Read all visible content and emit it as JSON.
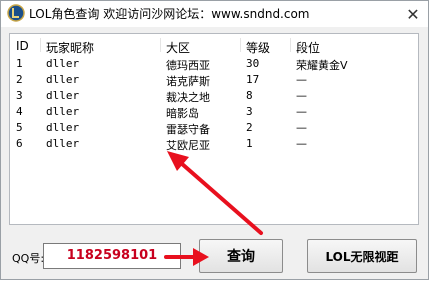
{
  "window": {
    "title": "LOL角色查询  欢迎访问沙网论坛：www.sndnd.com",
    "close_glyph": "✕"
  },
  "table": {
    "columns": [
      "ID",
      "玩家昵称",
      "大区",
      "等级",
      "段位"
    ],
    "rows": [
      {
        "id": "1",
        "name": "dller",
        "region": "德玛西亚",
        "level": "30",
        "rank": "荣耀黄金V"
      },
      {
        "id": "2",
        "name": "dller",
        "region": "诺克萨斯",
        "level": "17",
        "rank": "—"
      },
      {
        "id": "3",
        "name": "dller",
        "region": "裁决之地",
        "level": "8",
        "rank": "—"
      },
      {
        "id": "4",
        "name": "dller",
        "region": "暗影岛",
        "level": "3",
        "rank": "—"
      },
      {
        "id": "5",
        "name": "dller",
        "region": "雷瑟守备",
        "level": "2",
        "rank": "—"
      },
      {
        "id": "6",
        "name": "dller",
        "region": "艾欧尼亚",
        "level": "1",
        "rank": "—"
      }
    ]
  },
  "form": {
    "qq_label": "QQ号:",
    "qq_value": "1182598101",
    "query_button": "查询",
    "lol_button": "LOL无限视距"
  },
  "colors": {
    "annotation_arrow": "#e8101e",
    "qq_text": "#c8001e"
  },
  "icons": {
    "app": "lol-logo-icon",
    "close": "close-icon"
  }
}
